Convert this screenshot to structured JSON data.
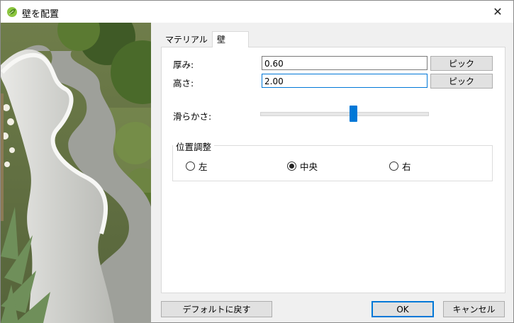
{
  "window": {
    "title": "壁を配置",
    "close_glyph": "✕"
  },
  "tabs": [
    {
      "label": "マテリアル",
      "active": false
    },
    {
      "label": "壁",
      "active": true
    }
  ],
  "form": {
    "thickness": {
      "label": "厚み:",
      "value": "0.60",
      "pick_label": "ピック"
    },
    "height": {
      "label": "高さ:",
      "value": "2.00",
      "pick_label": "ピック"
    },
    "smoothness": {
      "label": "滑らかさ:",
      "value_fraction": 0.56
    }
  },
  "alignment": {
    "title": "位置調整",
    "options": [
      {
        "label": "左",
        "selected": false
      },
      {
        "label": "中央",
        "selected": true
      },
      {
        "label": "右",
        "selected": false
      }
    ]
  },
  "footer": {
    "default_label": "デフォルトに戻す",
    "ok_label": "OK",
    "cancel_label": "キャンセル"
  },
  "colors": {
    "accent": "#0078d7",
    "dialog_bg": "#f0f0f0",
    "button_bg": "#e1e1e1"
  }
}
